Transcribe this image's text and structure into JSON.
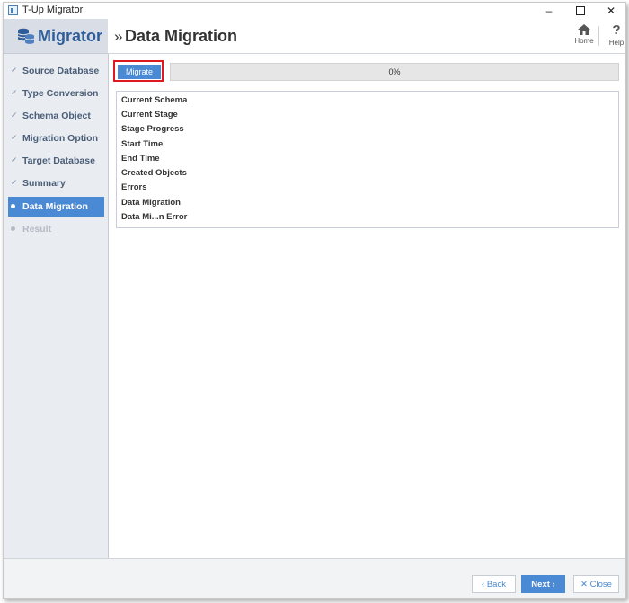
{
  "window": {
    "title": "T-Up Migrator"
  },
  "header": {
    "logo_text": "Migrator",
    "page_title": "Data Migration",
    "home_label": "Home",
    "help_label": "Help"
  },
  "sidebar": {
    "items": [
      {
        "label": "Source Database",
        "state": "done"
      },
      {
        "label": "Type Conversion",
        "state": "done"
      },
      {
        "label": "Schema Object",
        "state": "done"
      },
      {
        "label": "Migration Option",
        "state": "done"
      },
      {
        "label": "Target Database",
        "state": "done"
      },
      {
        "label": "Summary",
        "state": "done"
      },
      {
        "label": "Data Migration",
        "state": "active"
      },
      {
        "label": "Result",
        "state": "disabled"
      }
    ]
  },
  "main": {
    "migrate_label": "Migrate",
    "progress_value": 0,
    "progress_text": "0%",
    "info_rows": [
      "Current Schema",
      "Current Stage",
      "Stage Progress",
      "Start Time",
      "End Time",
      "Created Objects",
      "Errors",
      "Data Migration",
      "Data Mi...n Error"
    ]
  },
  "footer": {
    "back_label": "Back",
    "next_label": "Next",
    "close_label": "Close"
  },
  "colors": {
    "accent": "#4a89d4",
    "highlight": "#e0181f",
    "sidebar_bg": "#e9ecf1",
    "logo": "#2f5d98"
  }
}
